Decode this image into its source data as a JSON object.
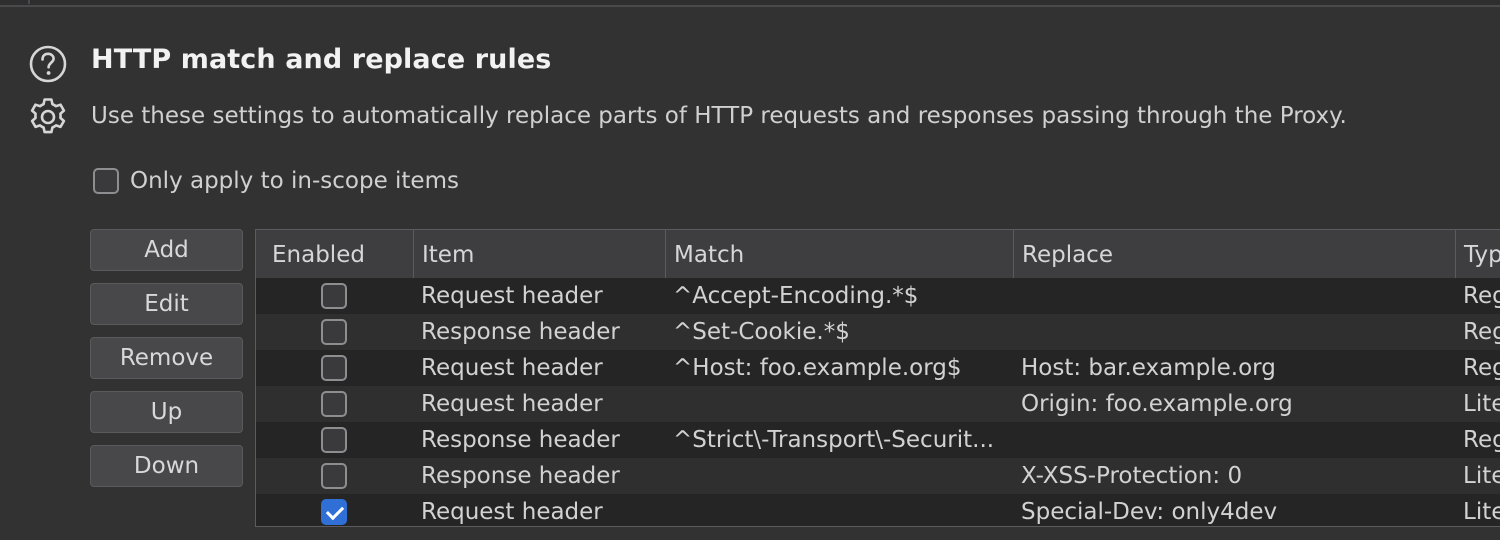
{
  "header": {
    "title": "HTTP match and replace rules",
    "description": "Use these settings to automatically replace parts of HTTP requests and responses passing through the Proxy."
  },
  "scope": {
    "label": "Only apply to in-scope items",
    "checked": false
  },
  "buttons": {
    "add": "Add",
    "edit": "Edit",
    "remove": "Remove",
    "up": "Up",
    "down": "Down"
  },
  "table": {
    "columns": [
      "Enabled",
      "Item",
      "Match",
      "Replace",
      "Typ"
    ],
    "rows": [
      {
        "enabled": false,
        "item": "Request header",
        "match": "^Accept-Encoding.*$",
        "replace": "",
        "type": "Reg"
      },
      {
        "enabled": false,
        "item": "Response header",
        "match": "^Set-Cookie.*$",
        "replace": "",
        "type": "Reg"
      },
      {
        "enabled": false,
        "item": "Request header",
        "match": "^Host: foo.example.org$",
        "replace": "Host: bar.example.org",
        "type": "Reg"
      },
      {
        "enabled": false,
        "item": "Request header",
        "match": "",
        "replace": "Origin: foo.example.org",
        "type": "Lite"
      },
      {
        "enabled": false,
        "item": "Response header",
        "match": "^Strict\\-Transport\\-Securit...",
        "replace": "",
        "type": "Reg"
      },
      {
        "enabled": false,
        "item": "Response header",
        "match": "",
        "replace": "X-XSS-Protection: 0",
        "type": "Lite"
      },
      {
        "enabled": true,
        "item": "Request header",
        "match": "",
        "replace": "Special-Dev: only4dev",
        "type": "Lite"
      }
    ]
  }
}
